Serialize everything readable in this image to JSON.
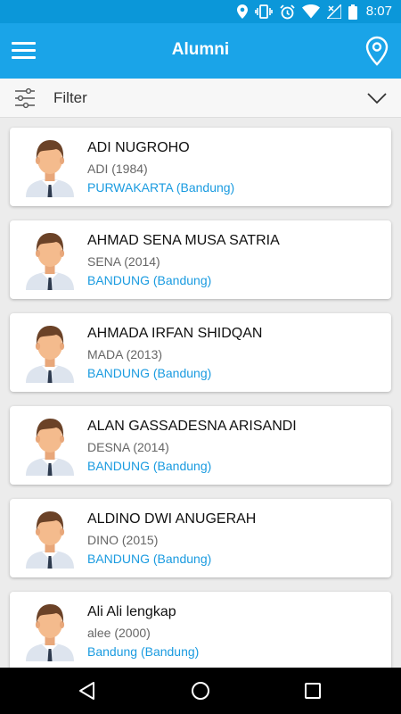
{
  "status_bar": {
    "time": "8:07",
    "icons": [
      "location-icon",
      "vibrate-icon",
      "alarm-icon",
      "wifi-icon",
      "no-signal-icon",
      "battery-icon"
    ]
  },
  "app_bar": {
    "title": "Alumni",
    "left_icon": "hamburger-menu-icon",
    "right_icon": "location-pin-icon"
  },
  "filter_bar": {
    "label": "Filter",
    "icon": "filter-sliders-icon",
    "toggle_icon": "chevron-down-icon"
  },
  "alumni": [
    {
      "name": "ADI NUGROHO",
      "nickname_year": "ADI (1984)",
      "city": "PURWAKARTA (Bandung)"
    },
    {
      "name": "AHMAD SENA MUSA SATRIA",
      "nickname_year": "SENA (2014)",
      "city": "BANDUNG (Bandung)"
    },
    {
      "name": "AHMADA IRFAN SHIDQAN",
      "nickname_year": "MADA (2013)",
      "city": "BANDUNG (Bandung)"
    },
    {
      "name": "ALAN GASSADESNA ARISANDI",
      "nickname_year": "DESNA (2014)",
      "city": "BANDUNG (Bandung)"
    },
    {
      "name": "ALDINO DWI ANUGERAH",
      "nickname_year": "DINO (2015)",
      "city": "BANDUNG (Bandung)"
    },
    {
      "name": "Ali Ali lengkap",
      "nickname_year": "alee (2000)",
      "city": "Bandung (Bandung)"
    }
  ],
  "nav_bar": {
    "icons": [
      "back-icon",
      "home-icon",
      "recents-icon"
    ]
  },
  "colors": {
    "status_bar": "#0b97d9",
    "app_bar": "#1aa4e8",
    "accent_text": "#1a9be0",
    "background": "#ececec"
  }
}
